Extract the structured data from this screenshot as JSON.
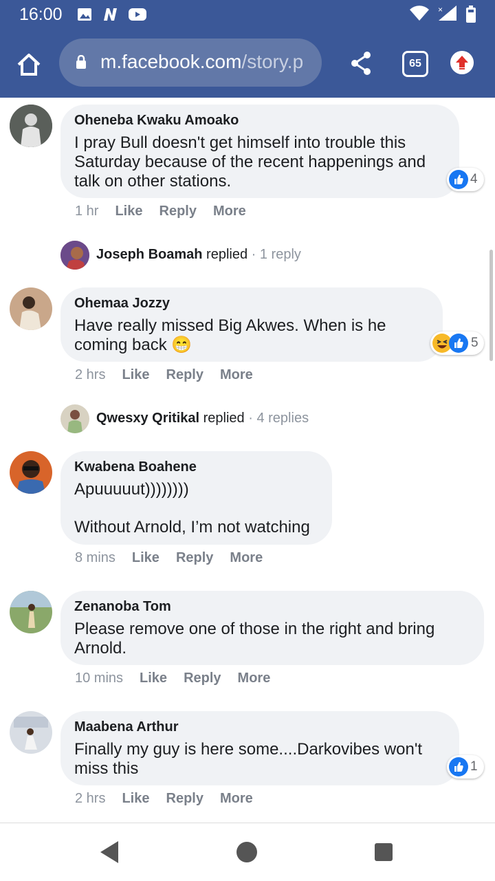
{
  "status": {
    "time": "16:00"
  },
  "browser": {
    "url_domain": "m.facebook.com",
    "url_path": "/story.p",
    "tab_count": "65"
  },
  "comments": [
    {
      "name": "Oheneba Kwaku Amoako",
      "text": "I pray Bull doesn't get himself into trouble this Saturday because of the recent happenings and talk on other stations.",
      "time": "1 hr",
      "like": "Like",
      "reply": "Reply",
      "more": "More",
      "reactions": "4"
    },
    {
      "name": "Ohemaa Jozzy",
      "text": "Have really missed Big Akwes. When is he coming back 😁",
      "time": "2 hrs",
      "like": "Like",
      "reply": "Reply",
      "more": "More",
      "reactions": "5"
    },
    {
      "name": "Kwabena Boahene",
      "text_line1": "Apuuuuut))))))))",
      "text_line2": "Without Arnold, I’m not watching",
      "time": "8 mins",
      "like": "Like",
      "reply": "Reply",
      "more": "More"
    },
    {
      "name": "Zenanoba Tom",
      "text": "Please remove one of those in the right and bring Arnold.",
      "time": "10 mins",
      "like": "Like",
      "reply": "Reply",
      "more": "More"
    },
    {
      "name": "Maabena Arthur",
      "text": "Finally my guy is here some....Darkovibes won't miss this",
      "time": "2 hrs",
      "like": "Like",
      "reply": "Reply",
      "more": "More",
      "reactions": "1"
    }
  ],
  "replies": [
    {
      "name": "Joseph Boamah",
      "verb": "replied",
      "count": "· 1 reply"
    },
    {
      "name": "Qwesxy Qritikal",
      "verb": "replied",
      "count": "· 4 replies"
    }
  ]
}
